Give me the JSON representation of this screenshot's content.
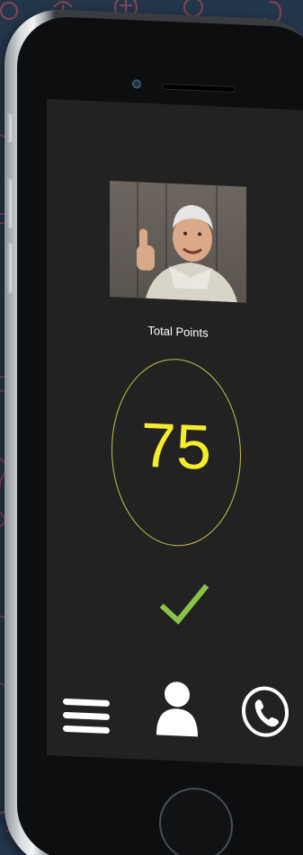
{
  "screen": {
    "total_label": "Total Points",
    "score": "75"
  },
  "icons": {
    "photo": "senior-man-thumbs-up-photo",
    "check": "checkmark-icon",
    "menu": "hamburger-menu-icon",
    "profile": "user-profile-icon",
    "call": "phone-call-icon"
  },
  "colors": {
    "background": "#24364a",
    "screen": "#222222",
    "score": "#f5ec2a",
    "ring": "#c7c24a",
    "check": "#8bc34a",
    "icons": "#ffffff"
  }
}
